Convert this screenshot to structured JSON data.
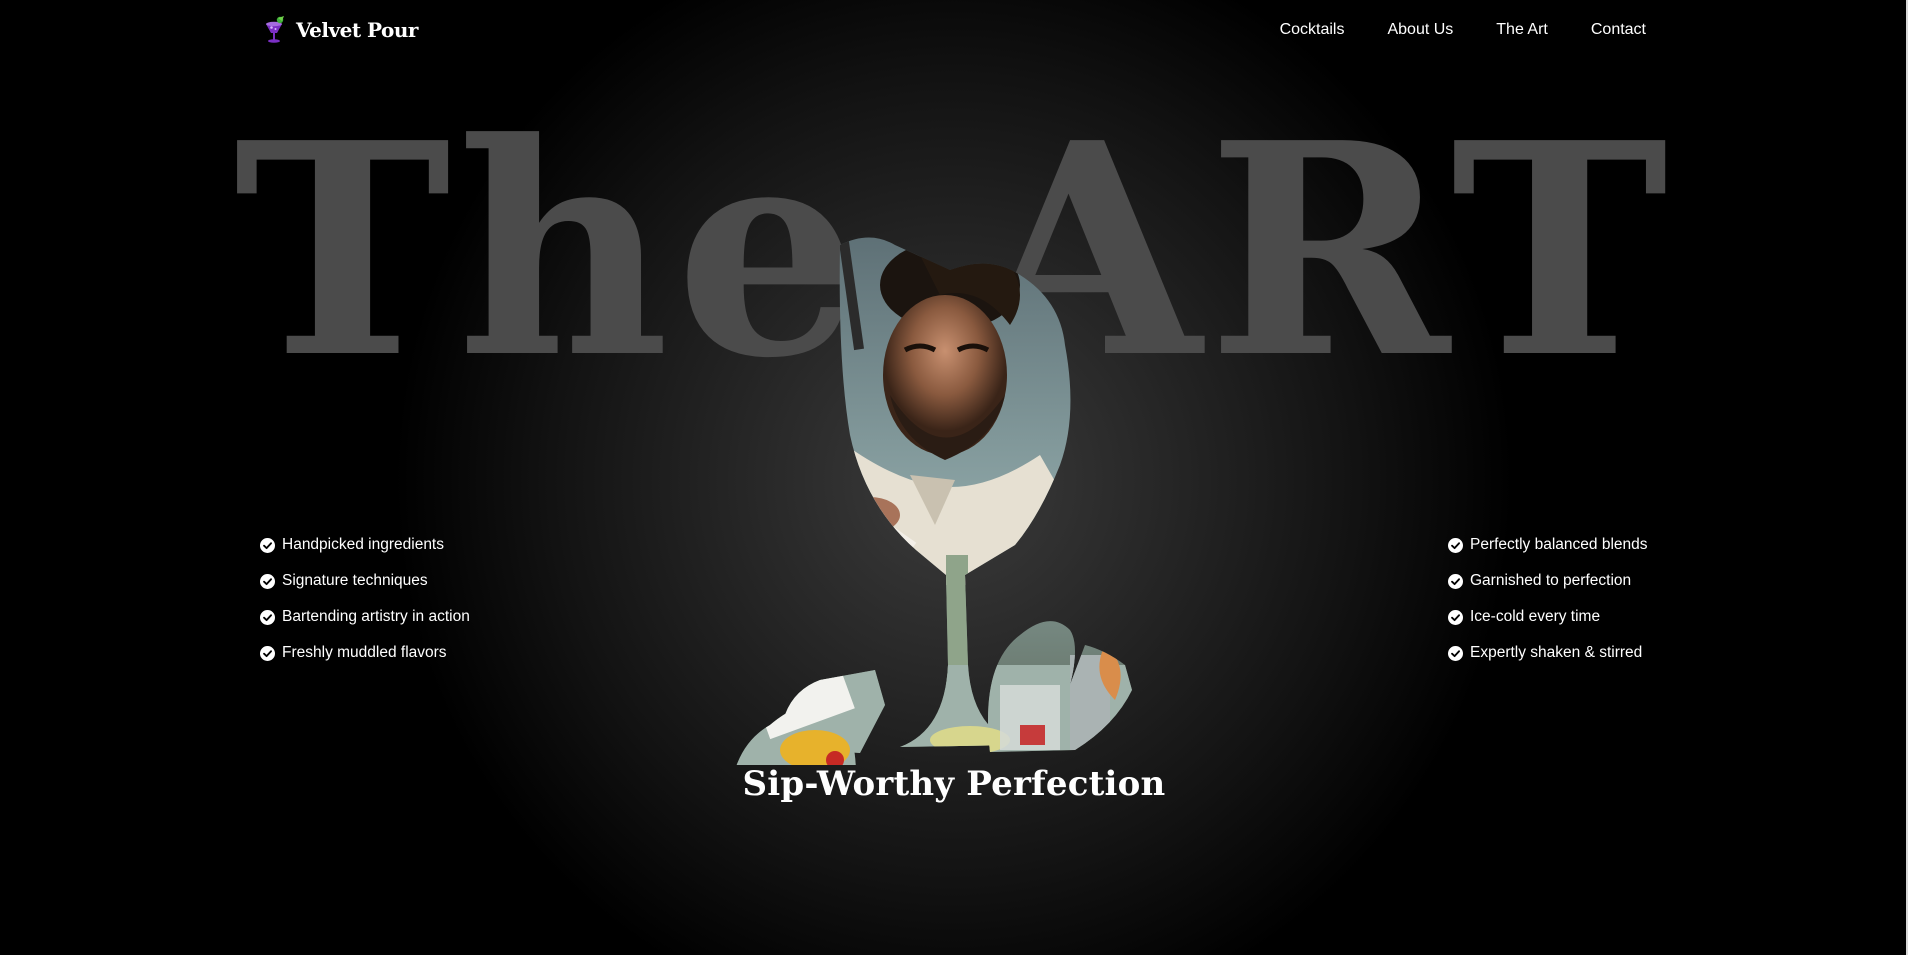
{
  "brand": {
    "name": "Velvet Pour",
    "logo_icon": "cocktail-glass-icon",
    "logo_color": "#7b2fc4"
  },
  "nav": {
    "links": [
      {
        "label": "Cocktails"
      },
      {
        "label": "About Us"
      },
      {
        "label": "The Art"
      },
      {
        "label": "Contact"
      }
    ]
  },
  "hero": {
    "title": "The ART",
    "subtitle": "Sip-Worthy Perfection",
    "title_color": "#4b4b4b"
  },
  "features_left": [
    {
      "text": "Handpicked ingredients",
      "icon": "check-circle-icon"
    },
    {
      "text": "Signature techniques",
      "icon": "check-circle-icon"
    },
    {
      "text": "Bartending artistry in action",
      "icon": "check-circle-icon"
    },
    {
      "text": "Freshly muddled flavors",
      "icon": "check-circle-icon"
    }
  ],
  "features_right": [
    {
      "text": "Perfectly balanced blends",
      "icon": "check-circle-icon"
    },
    {
      "text": "Garnished to perfection",
      "icon": "check-circle-icon"
    },
    {
      "text": "Ice-cold every time",
      "icon": "check-circle-icon"
    },
    {
      "text": "Expertly shaken & stirred",
      "icon": "check-circle-icon"
    }
  ],
  "image": {
    "subject": "bartender-in-glass-image"
  }
}
